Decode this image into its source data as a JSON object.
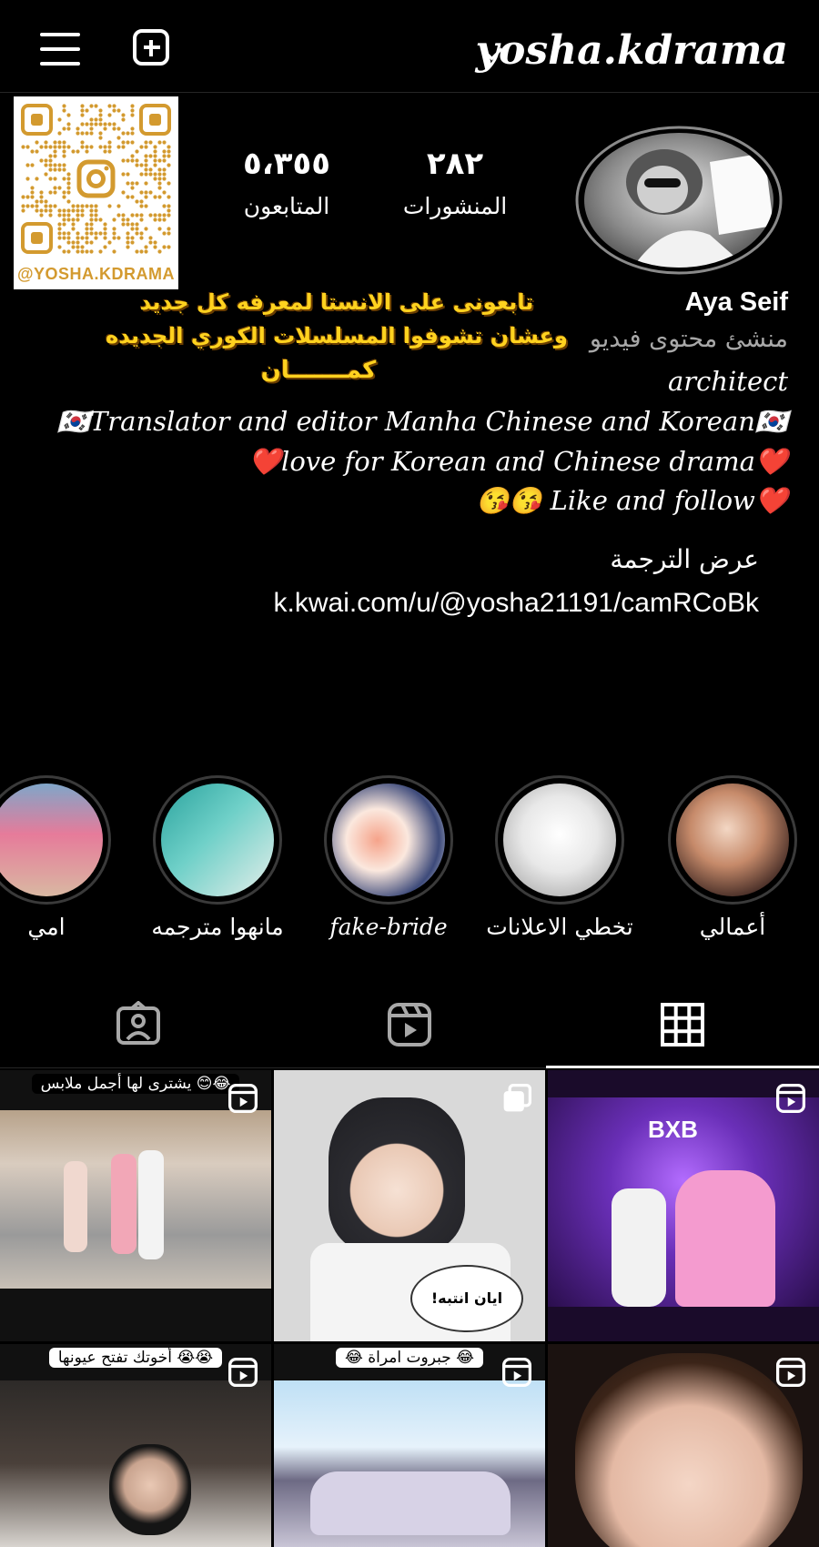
{
  "header": {
    "username": "yosha.kdrama",
    "menu_icon": "hamburger-menu-icon",
    "create_icon": "plus-square-icon",
    "dropdown_icon": "chevron-down-icon"
  },
  "qr": {
    "handle": "@YOSHA.KDRAMA",
    "color": "#d39a2f"
  },
  "stats": {
    "posts_count": "٢٨٢",
    "posts_label": "المنشورات",
    "followers_count": "٥،٣٥٥",
    "followers_label": "المتابعون"
  },
  "promo": {
    "line1": "تابعونى على الانستا لمعرفه كل جديد",
    "line2": "وعشان تشوفوا المسلسلات الكوري الجديده",
    "line3": "كمـــــــان"
  },
  "bio": {
    "name": "Aya Seif",
    "category": "منشئ محتوى فيديو",
    "line1": "architect",
    "line2": "🇰🇷Translator and editor Manha Chinese and Korean🇰🇷",
    "line3": "❤️love for Korean and Chinese drama❤️",
    "line4": "😘😘 Like and follow❤️",
    "see_translation": "عرض الترجمة",
    "link": "k.kwai.com/u/@yosha21191/camRCoBk"
  },
  "highlights": [
    {
      "label": "أعمالي"
    },
    {
      "label": "تخطي الاعلانات"
    },
    {
      "label": "fake-bride"
    },
    {
      "label": "مانهوا مترجمه"
    },
    {
      "label": "امي"
    }
  ],
  "tabs": {
    "grid_icon": "grid-icon",
    "reels_icon": "reels-icon",
    "tagged_icon": "tagged-person-icon"
  },
  "posts": {
    "caption1": "يشترى لها أجمل ملابس 😊😂",
    "caption2": "أخوتك تفتح عيونها 😭😭",
    "caption3": "😂 جبروت امراة 😂",
    "overlay_bxb": "BXB",
    "overlay_bubble": "!ايان انتبه"
  },
  "colors": {
    "background": "#000000",
    "text": "#ffffff",
    "secondary": "#a8a8a8",
    "promo_yellow": "#ffd21f"
  }
}
